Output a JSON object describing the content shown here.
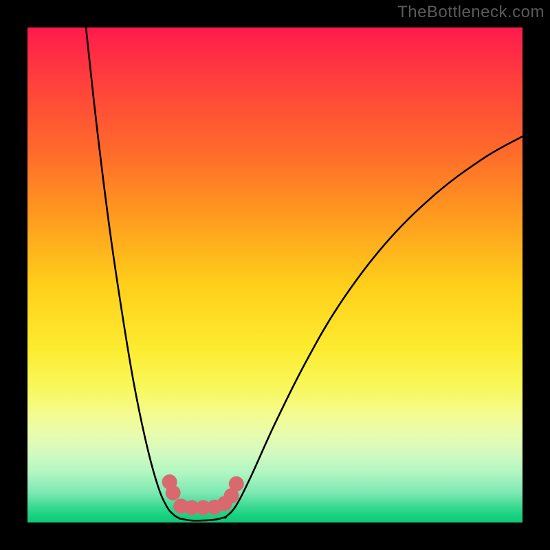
{
  "watermark": "TheBottleneck.com",
  "chart_data": {
    "type": "line",
    "title": "",
    "xlabel": "",
    "ylabel": "",
    "xlim": [
      0,
      100
    ],
    "ylim": [
      0,
      100
    ],
    "grid": false,
    "legend": false,
    "series": [
      {
        "name": "left-branch",
        "x": [
          11.8,
          14.0,
          16.5,
          19.0,
          21.5,
          24.0,
          26.3,
          28.1,
          29.6,
          30.8
        ],
        "y": [
          100.0,
          80.0,
          60.0,
          43.0,
          28.0,
          16.0,
          7.5,
          3.3,
          1.5,
          0.8
        ]
      },
      {
        "name": "flat-bottom",
        "x": [
          30.8,
          33.0,
          35.5,
          38.0,
          40.0
        ],
        "y": [
          0.8,
          0.4,
          0.4,
          0.6,
          1.1
        ]
      },
      {
        "name": "right-branch",
        "x": [
          40.0,
          42.0,
          45.0,
          50.0,
          56.0,
          63.0,
          72.0,
          82.0,
          92.0,
          100.0
        ],
        "y": [
          1.1,
          3.2,
          9.0,
          20.0,
          32.0,
          44.0,
          56.0,
          66.0,
          73.5,
          78.0
        ]
      }
    ],
    "markers": {
      "name": "bottom-highlight",
      "color": "#d86a6f",
      "points": [
        {
          "x": 28.7,
          "y": 8.2
        },
        {
          "x": 29.4,
          "y": 6.0
        },
        {
          "x": 31.0,
          "y": 3.3
        },
        {
          "x": 33.2,
          "y": 3.0
        },
        {
          "x": 35.5,
          "y": 3.0
        },
        {
          "x": 37.8,
          "y": 3.1
        },
        {
          "x": 39.8,
          "y": 3.8
        },
        {
          "x": 41.2,
          "y": 5.4
        },
        {
          "x": 42.2,
          "y": 7.8
        }
      ]
    }
  }
}
